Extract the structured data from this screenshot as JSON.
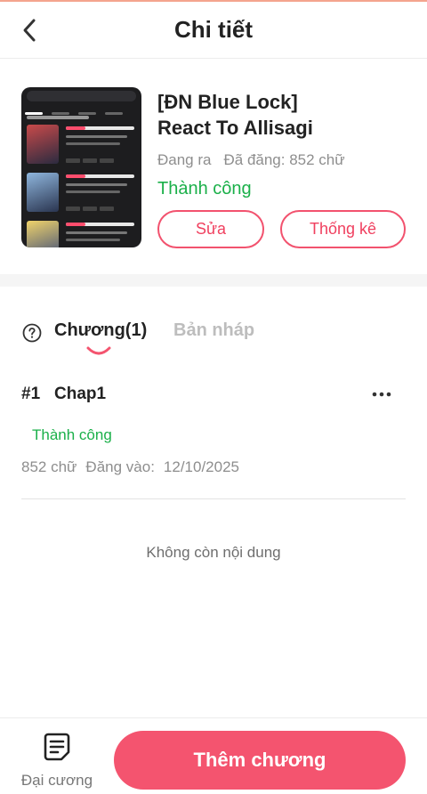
{
  "header": {
    "title": "Chi tiết"
  },
  "story": {
    "title_line1": "[ĐN Blue Lock]",
    "title_line2": "React To Allisagi",
    "state": "Đang ra",
    "words": "Đã đăng: 852 chữ",
    "status": "Thành công",
    "edit_label": "Sửa",
    "stats_label": "Thống kê"
  },
  "tabs": {
    "chapters": "Chương(1)",
    "drafts": "Bản nháp"
  },
  "chapters": [
    {
      "num": "#1",
      "title": "Chap1",
      "status": "Thành công",
      "words": "852 chữ",
      "posted_label": "Đăng vào:",
      "posted_date": "12/10/2025"
    }
  ],
  "empty_text": "Không còn nội dung",
  "bottom": {
    "outline_label": "Đại cương",
    "add_label": "Thêm chương"
  },
  "colors": {
    "accent": "#f4546f",
    "success": "#1bb04a",
    "muted": "#8e8e8e"
  }
}
